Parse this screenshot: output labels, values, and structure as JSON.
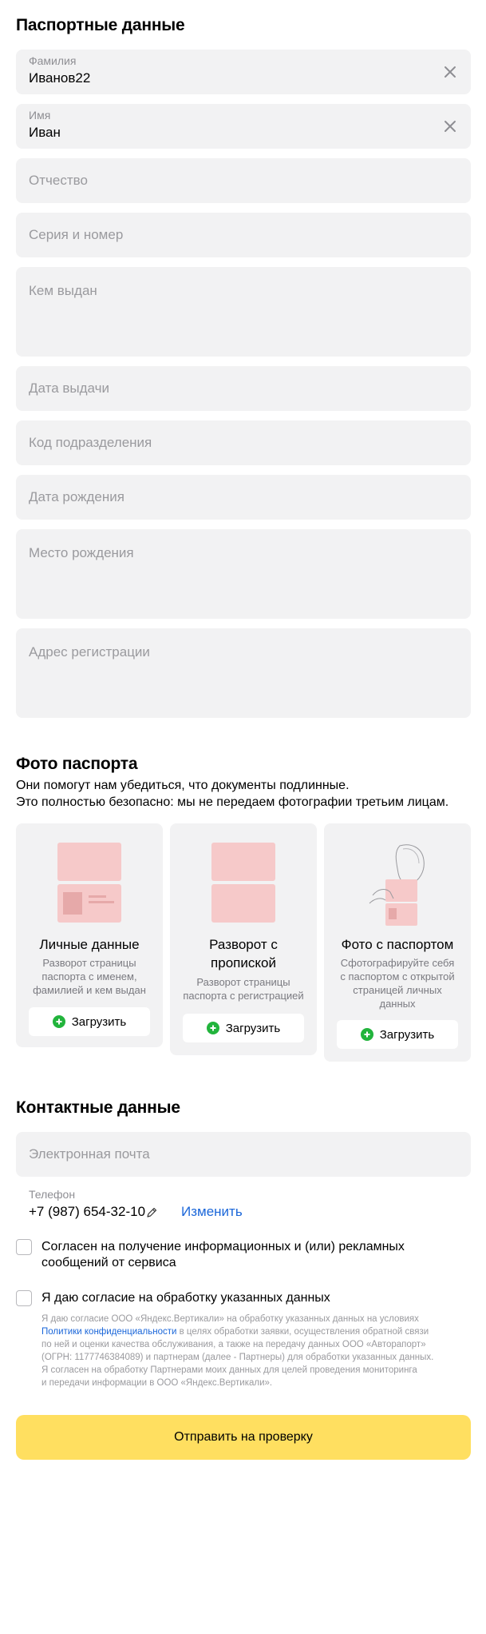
{
  "passport": {
    "title": "Паспортные данные",
    "surname": {
      "label": "Фамилия",
      "value": "Иванов22"
    },
    "name": {
      "label": "Имя",
      "value": "Иван"
    },
    "patronymic_placeholder": "Отчество",
    "series_number_placeholder": "Серия и номер",
    "issued_by_placeholder": "Кем выдан",
    "issue_date_placeholder": "Дата выдачи",
    "division_code_placeholder": "Код подразделения",
    "birth_date_placeholder": "Дата рождения",
    "birth_place_placeholder": "Место рождения",
    "registration_address_placeholder": "Адрес регистрации"
  },
  "photos": {
    "title": "Фото паспорта",
    "description_line1": "Они помогут нам убедиться, что документы подлинные.",
    "description_line2": "Это полностью безопасно: мы не передаем фотографии третьим лицам.",
    "cards": [
      {
        "title_lines": [
          "Личные данные"
        ],
        "subtitle_lines": [
          "Разворот страницы",
          "паспорта с именем,",
          "фамилией и кем выдан"
        ],
        "button": "Загрузить",
        "icon": "passport-personal-page-icon"
      },
      {
        "title_lines": [
          "Разворот с",
          "пропиской"
        ],
        "subtitle_lines": [
          "Разворот страницы",
          "паспорта с регистрацией"
        ],
        "button": "Загрузить",
        "icon": "passport-registration-page-icon"
      },
      {
        "title_lines": [
          "Фото с паспортом"
        ],
        "subtitle_lines": [
          "Сфотографируйте себя",
          "с паспортом с открытой",
          "страницей личных",
          "данных"
        ],
        "button": "Загрузить",
        "icon": "selfie-with-passport-icon"
      }
    ]
  },
  "contacts": {
    "title": "Контактные данные",
    "email_placeholder": "Электронная почта",
    "phone_label": "Телефон",
    "phone_value": "+7 (987) 654-32-10",
    "change_link": "Изменить"
  },
  "consents": {
    "marketing_line1": "Согласен на получение информационных и (или) рекламных",
    "marketing_line2": "сообщений от сервиса",
    "processing": "Я даю согласие на обработку указанных данных",
    "legal_line1": "Я даю согласие ООО «Яндекс.Вертикали» на обработку указанных данных на условиях",
    "legal_link": "Политики конфиденциальности",
    "legal_line2_rest": " в целях обработки заявки, осуществления обратной связи",
    "legal_line3": "по ней и оценки качества обслуживания, а также на передачу данных ООО «Авторапорт»",
    "legal_line4": "(ОГРН: 1177746384089) и партнерам (далее - Партнеры) для обработки указанных данных.",
    "legal_line5": "Я согласен на обработку Партнерами моих данных для целей проведения мониторинга",
    "legal_line6": "и передачи информации в ООО «Яндекс.Вертикали»."
  },
  "submit_label": "Отправить на проверку",
  "colors": {
    "field_bg": "#f2f2f3",
    "accent_yellow": "#ffdf60",
    "link_blue": "#1a66d9",
    "upload_green": "#22b43c",
    "doc_pink": "#f6c9c9"
  }
}
